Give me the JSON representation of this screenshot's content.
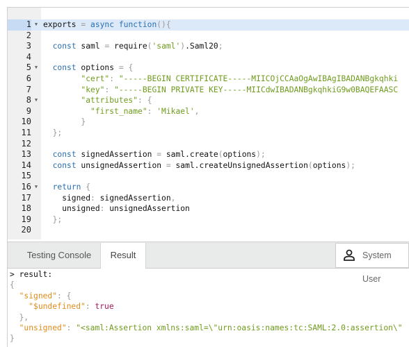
{
  "editor": {
    "active_line": 1,
    "fold_lines": [
      1,
      5,
      8,
      16
    ],
    "lines": [
      [
        [
          "id",
          "exports "
        ],
        [
          "pun",
          "= "
        ],
        [
          "kw",
          "async function"
        ],
        [
          "pun",
          "(){"
        ]
      ],
      [],
      [
        [
          "id",
          "  "
        ],
        [
          "kw",
          "const "
        ],
        [
          "id",
          "saml "
        ],
        [
          "pun",
          "= "
        ],
        [
          "id",
          "require"
        ],
        [
          "pun",
          "("
        ],
        [
          "str",
          "'saml'"
        ],
        [
          "pun",
          ")"
        ],
        [
          "id",
          ".Saml20"
        ],
        [
          "pun",
          ";"
        ]
      ],
      [],
      [
        [
          "id",
          "  "
        ],
        [
          "kw",
          "const "
        ],
        [
          "id",
          "options "
        ],
        [
          "pun",
          "= {"
        ]
      ],
      [
        [
          "id",
          "        "
        ],
        [
          "str",
          "\"cert\""
        ],
        [
          "pun",
          ": "
        ],
        [
          "str",
          "\"-----BEGIN CERTIFICATE-----MIICOjCCAaOgAwIBAgIBADANBgkqhki"
        ]
      ],
      [
        [
          "id",
          "        "
        ],
        [
          "str",
          "\"key\""
        ],
        [
          "pun",
          ": "
        ],
        [
          "str",
          "\"-----BEGIN PRIVATE KEY-----MIICdwIBADANBgkqhkiG9w0BAQEFAASC"
        ]
      ],
      [
        [
          "id",
          "        "
        ],
        [
          "str",
          "\"attributes\""
        ],
        [
          "pun",
          ": {"
        ]
      ],
      [
        [
          "id",
          "          "
        ],
        [
          "str",
          "\"first_name\""
        ],
        [
          "pun",
          ": "
        ],
        [
          "str",
          "'Mikael'"
        ],
        [
          "pun",
          ","
        ]
      ],
      [
        [
          "id",
          "        "
        ],
        [
          "pun",
          "}"
        ]
      ],
      [
        [
          "id",
          "  "
        ],
        [
          "pun",
          "};"
        ]
      ],
      [],
      [
        [
          "id",
          "  "
        ],
        [
          "kw",
          "const "
        ],
        [
          "id",
          "signedAssertion "
        ],
        [
          "pun",
          "= "
        ],
        [
          "id",
          "saml.create"
        ],
        [
          "pun",
          "("
        ],
        [
          "id",
          "options"
        ],
        [
          "pun",
          ");"
        ]
      ],
      [
        [
          "id",
          "  "
        ],
        [
          "kw",
          "const "
        ],
        [
          "id",
          "unsignedAssertion "
        ],
        [
          "pun",
          "= "
        ],
        [
          "id",
          "saml.createUnsignedAssertion"
        ],
        [
          "pun",
          "("
        ],
        [
          "id",
          "options"
        ],
        [
          "pun",
          ");"
        ]
      ],
      [],
      [
        [
          "id",
          "  "
        ],
        [
          "kw",
          "return "
        ],
        [
          "pun",
          "{"
        ]
      ],
      [
        [
          "id",
          "    signed"
        ],
        [
          "pun",
          ": "
        ],
        [
          "id",
          "signedAssertion"
        ],
        [
          "pun",
          ","
        ]
      ],
      [
        [
          "id",
          "    unsigned"
        ],
        [
          "pun",
          ": "
        ],
        [
          "id",
          "unsignedAssertion"
        ]
      ],
      [
        [
          "id",
          "  "
        ],
        [
          "pun",
          "};"
        ]
      ],
      []
    ]
  },
  "tabs": [
    {
      "label": "Testing Console",
      "selected": false
    },
    {
      "label": "Result",
      "selected": true
    }
  ],
  "user": {
    "icon": "user-icon",
    "label": "System User"
  },
  "console": [
    [
      [
        "id",
        "> result:"
      ]
    ],
    [
      [
        "pun",
        "{"
      ]
    ],
    [
      [
        "id",
        "  "
      ],
      [
        "key",
        "\"signed\""
      ],
      [
        "pun",
        ": {"
      ]
    ],
    [
      [
        "id",
        "    "
      ],
      [
        "key",
        "\"$undefined\""
      ],
      [
        "pun",
        ": "
      ],
      [
        "bool",
        "true"
      ]
    ],
    [
      [
        "id",
        "  "
      ],
      [
        "pun",
        "},"
      ]
    ],
    [
      [
        "id",
        "  "
      ],
      [
        "key",
        "\"unsigned\""
      ],
      [
        "pun",
        ": "
      ],
      [
        "str",
        "\"<saml:Assertion xmlns:saml=\\\"urn:oasis:names:tc:SAML:2.0:assertion\\\""
      ]
    ],
    [
      [
        "pun",
        "}"
      ]
    ]
  ],
  "colors": {
    "keyword": "#2a6fb0",
    "string": "#6f9b1d",
    "key": "#e08b1a",
    "boolean": "#a01659",
    "active_line": "#dce9f9"
  }
}
